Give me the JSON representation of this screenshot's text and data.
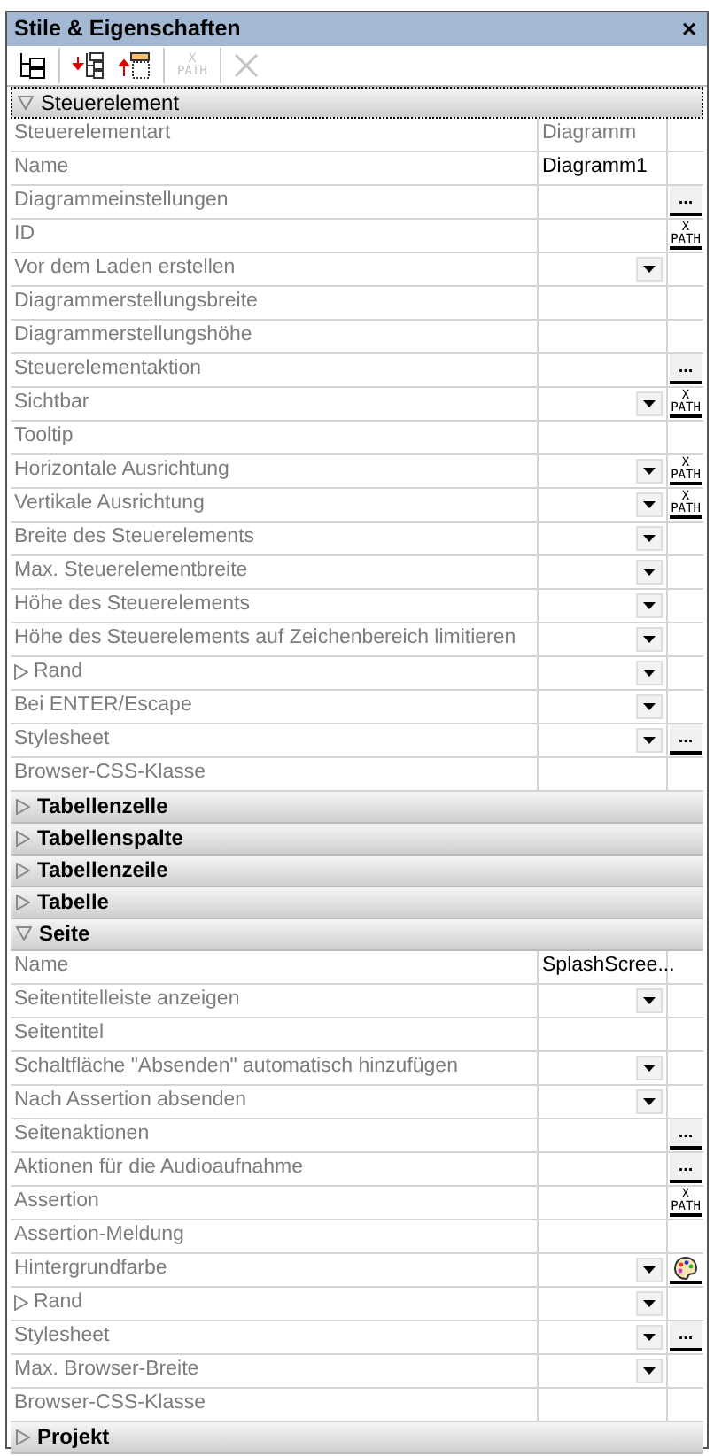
{
  "window": {
    "title": "Stile & Eigenschaften",
    "close": "×"
  },
  "toolbar": [
    {
      "kind": "tree",
      "disabled": false
    },
    {
      "kind": "insert",
      "disabled": false
    },
    {
      "kind": "append",
      "disabled": false
    },
    {
      "kind": "xpath",
      "lines": [
        "X",
        "PATH"
      ],
      "disabled": true
    },
    {
      "kind": "delete",
      "disabled": true
    }
  ],
  "sections": [
    {
      "title": "Steuerelement",
      "expanded": true,
      "selected": true,
      "rows": [
        {
          "kind": "property",
          "label": "Steuerelementart",
          "value": {
            "text": "Diagramm",
            "readonly": true
          },
          "dropdown": false
        },
        {
          "kind": "property",
          "label": "Name",
          "value": {
            "text": "Diagramm1",
            "readonly": false
          },
          "dropdown": false
        },
        {
          "kind": "property",
          "label": "Diagrammeinstellungen",
          "dropdown": false,
          "button": {
            "kind": "text",
            "text": "..."
          }
        },
        {
          "kind": "property",
          "label": "ID",
          "dropdown": false,
          "button": {
            "kind": "xpath",
            "lines": [
              "X",
              "PATH"
            ]
          }
        },
        {
          "kind": "property",
          "label": "Vor dem Laden erstellen",
          "dropdown": true
        },
        {
          "kind": "property",
          "label": "Diagrammerstellungsbreite",
          "dropdown": false
        },
        {
          "kind": "property",
          "label": "Diagrammerstellungshöhe",
          "dropdown": false
        },
        {
          "kind": "property",
          "label": "Steuerelementaktion",
          "dropdown": false,
          "button": {
            "kind": "text",
            "text": "..."
          }
        },
        {
          "kind": "property",
          "label": "Sichtbar",
          "dropdown": true,
          "button": {
            "kind": "xpath",
            "lines": [
              "X",
              "PATH"
            ]
          }
        },
        {
          "kind": "property",
          "label": "Tooltip",
          "dropdown": false
        },
        {
          "kind": "property",
          "label": "Horizontale Ausrichtung",
          "dropdown": true,
          "button": {
            "kind": "xpath",
            "lines": [
              "X",
              "PATH"
            ]
          }
        },
        {
          "kind": "property",
          "label": "Vertikale Ausrichtung",
          "dropdown": true,
          "button": {
            "kind": "xpath",
            "lines": [
              "X",
              "PATH"
            ]
          }
        },
        {
          "kind": "property",
          "label": "Breite des Steuerelements",
          "dropdown": true
        },
        {
          "kind": "property",
          "label": "Max. Steuerelementbreite",
          "dropdown": true
        },
        {
          "kind": "property",
          "label": "Höhe des Steuerelements",
          "dropdown": true
        },
        {
          "kind": "property",
          "label": "Höhe des Steuerelements auf Zeichenbereich limitieren",
          "dropdown": true
        },
        {
          "kind": "group",
          "label": "Rand",
          "expanded": false,
          "dropdown": true
        },
        {
          "kind": "property",
          "label": "Bei ENTER/Escape",
          "dropdown": true
        },
        {
          "kind": "property",
          "label": "Stylesheet",
          "dropdown": true,
          "button": {
            "kind": "text",
            "text": "..."
          }
        },
        {
          "kind": "property",
          "label": "Browser-CSS-Klasse",
          "dropdown": false
        }
      ]
    },
    {
      "title": "Tabellenzelle",
      "expanded": false,
      "selected": false
    },
    {
      "title": "Tabellenspalte",
      "expanded": false,
      "selected": false
    },
    {
      "title": "Tabellenzeile",
      "expanded": false,
      "selected": false
    },
    {
      "title": "Tabelle",
      "expanded": false,
      "selected": false
    },
    {
      "title": "Seite",
      "expanded": true,
      "selected": false,
      "rows": [
        {
          "kind": "property",
          "label": "Name",
          "value": {
            "text": "SplashScree...",
            "readonly": false
          },
          "dropdown": false
        },
        {
          "kind": "property",
          "label": "Seitentitelleiste anzeigen",
          "dropdown": true
        },
        {
          "kind": "property",
          "label": "Seitentitel",
          "dropdown": false
        },
        {
          "kind": "property",
          "label": "Schaltfläche \"Absenden\" automatisch hinzufügen",
          "dropdown": true
        },
        {
          "kind": "property",
          "label": "Nach Assertion absenden",
          "dropdown": true
        },
        {
          "kind": "property",
          "label": "Seitenaktionen",
          "dropdown": false,
          "button": {
            "kind": "text",
            "text": "..."
          }
        },
        {
          "kind": "property",
          "label": "Aktionen für die Audioaufnahme",
          "dropdown": false,
          "button": {
            "kind": "text",
            "text": "..."
          }
        },
        {
          "kind": "property",
          "label": "Assertion",
          "dropdown": false,
          "button": {
            "kind": "xpath",
            "lines": [
              "X",
              "PATH"
            ]
          }
        },
        {
          "kind": "property",
          "label": "Assertion-Meldung",
          "dropdown": false
        },
        {
          "kind": "property",
          "label": "Hintergrundfarbe",
          "dropdown": true,
          "button": {
            "kind": "palette"
          }
        },
        {
          "kind": "group",
          "label": "Rand",
          "expanded": false,
          "dropdown": true
        },
        {
          "kind": "property",
          "label": "Stylesheet",
          "dropdown": true,
          "button": {
            "kind": "text",
            "text": "..."
          }
        },
        {
          "kind": "property",
          "label": "Max. Browser-Breite",
          "dropdown": true
        },
        {
          "kind": "property",
          "label": "Browser-CSS-Klasse",
          "dropdown": false
        }
      ]
    },
    {
      "title": "Projekt",
      "expanded": false,
      "selected": false
    }
  ]
}
